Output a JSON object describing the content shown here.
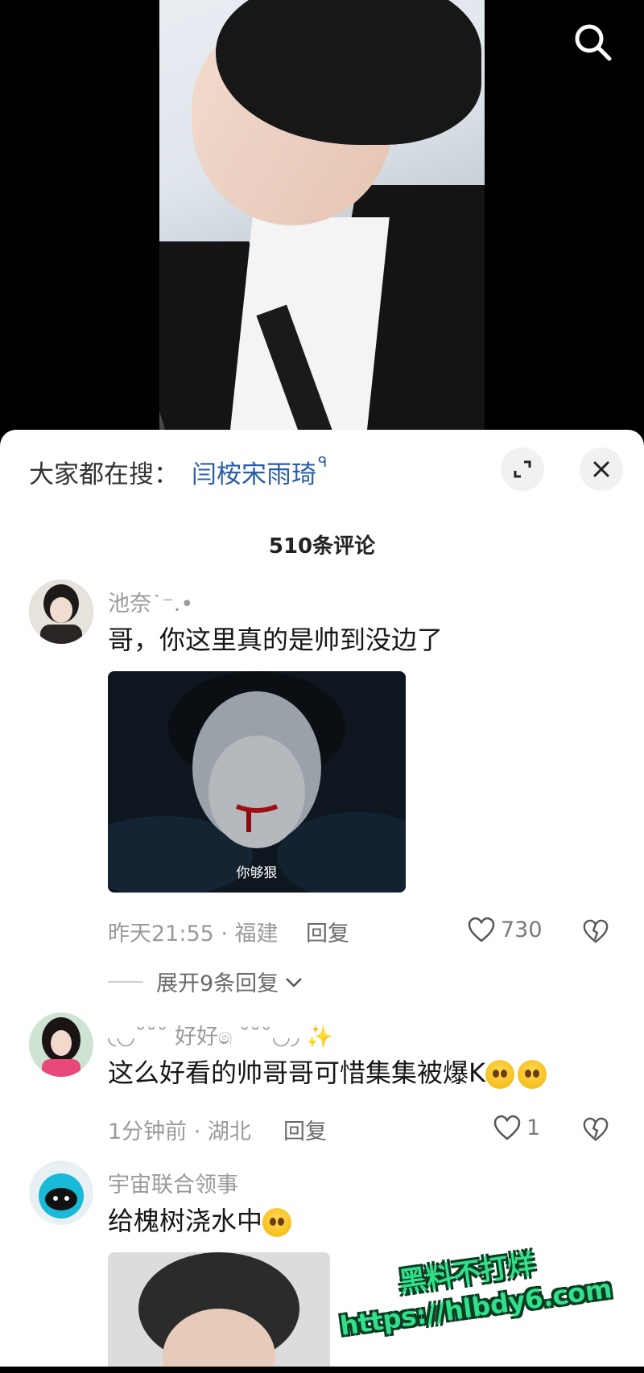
{
  "header": {
    "hot_search_label": "大家都在搜：",
    "hot_search_term": "闫桉宋雨琦",
    "hot_search_suffix": "ᑫ"
  },
  "comments_count_title": "510条评论",
  "comments": [
    {
      "username": "池奈˙⁻.•",
      "text": "哥，你这里真的是帅到没边了",
      "image_caption": "你够狠",
      "time_location": "昨天21:55 · 福建",
      "reply_label": "回复",
      "likes": "730",
      "expand_label": "展开9条回复"
    },
    {
      "username": "◟◡˘˘˘ 好好෧ ˘˘˘◡◞  ✨",
      "text": "这么好看的帅哥哥可惜集集被爆K",
      "time_location": "1分钟前 · 湖北",
      "reply_label": "回复",
      "likes": "1"
    },
    {
      "username": "宇宙联合领事",
      "text": "给槐树浇水中"
    }
  ],
  "watermark": {
    "line1": "黑料不打烊",
    "line2": "https://hlbdy6.com"
  },
  "colors": {
    "accent_link": "#2a5da8",
    "meta_gray": "#9a9a9a",
    "watermark_green": "#31e08a"
  },
  "icons": [
    "search-icon",
    "expand-icon",
    "close-icon",
    "heart-icon",
    "broken-heart-icon",
    "chevron-down-icon"
  ]
}
